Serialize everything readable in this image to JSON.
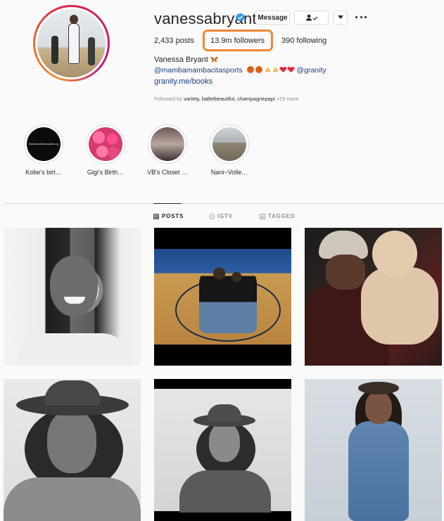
{
  "profile": {
    "username": "vanessabryant",
    "full_name": "Vanessa Bryant",
    "bio_handle": "@mambamambacitasports",
    "bio_handle2": "@granity",
    "link": "granity.me/books",
    "followed_by_prefix": "Followed by",
    "followed_by_names": "variety, balletbeautiful, champagnepapi",
    "followed_by_more": "+29 more"
  },
  "actions": {
    "message_label": "Message",
    "more_icon": "ellipsis-icon",
    "follow_icon": "person-check-icon",
    "dropdown_icon": "chevron-down-icon"
  },
  "stats": {
    "posts": "2,433 posts",
    "followers": "13.9m followers",
    "following": "390 following"
  },
  "highlights": [
    {
      "label": "Kobe's birt…",
      "cover_text": "MambaandMambacitas.org"
    },
    {
      "label": "Gigi's Birth…"
    },
    {
      "label": "VB's Closet …"
    },
    {
      "label": "Nani~Volle…"
    }
  ],
  "tabs": [
    {
      "label": "POSTS",
      "icon": "grid-icon",
      "active": true
    },
    {
      "label": "IGTV",
      "icon": "igtv-icon",
      "active": false
    },
    {
      "label": "TAGGED",
      "icon": "tag-icon",
      "active": false
    }
  ],
  "colors": {
    "link": "#1b3f7a",
    "annotation_box": "#f0883a",
    "verified": "#3897f0"
  }
}
